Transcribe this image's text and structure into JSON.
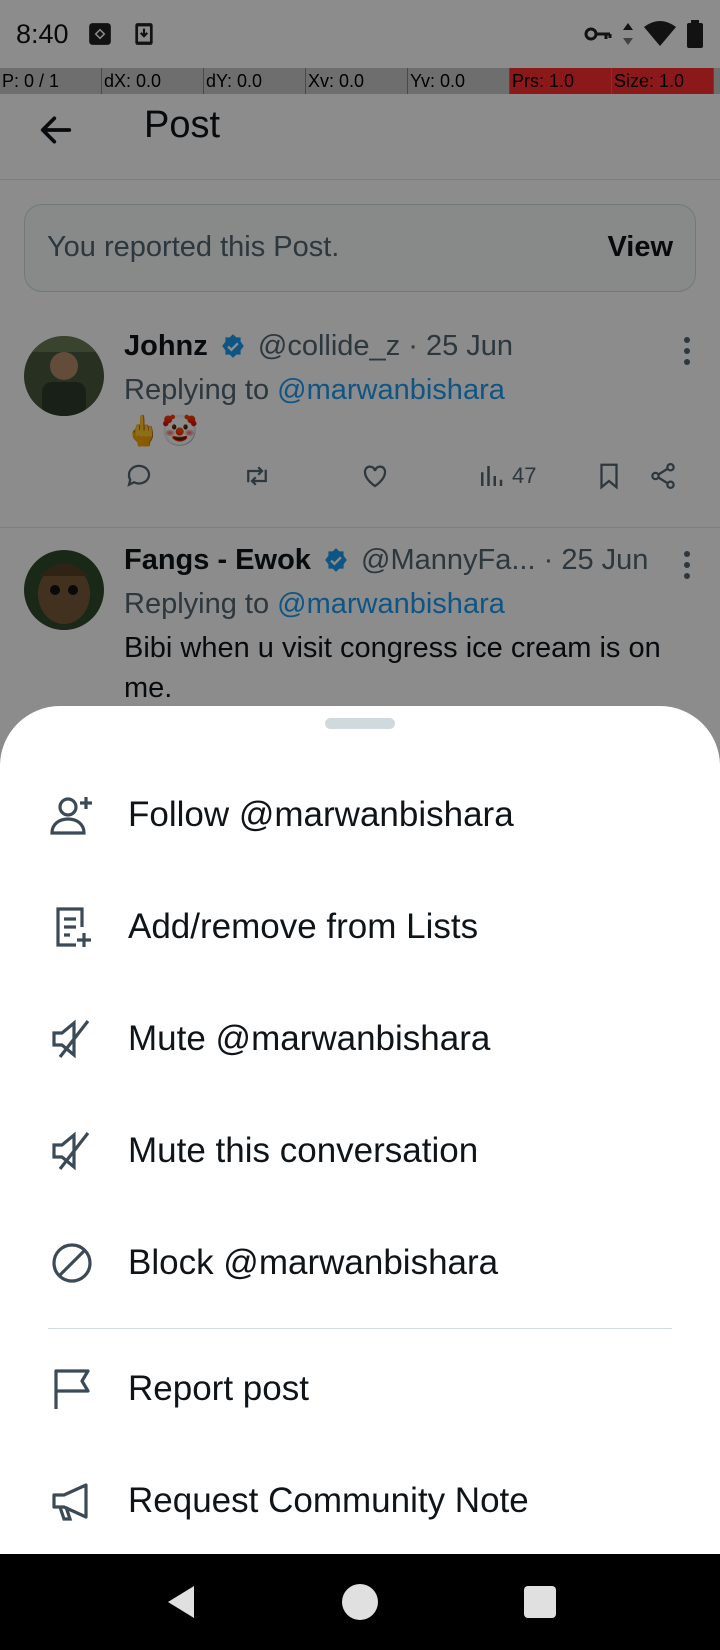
{
  "status_bar": {
    "time": "8:40",
    "icons": [
      "sync-icon",
      "download-icon",
      "vpn-key-icon",
      "data-arrows-icon",
      "wifi-icon",
      "battery-icon"
    ]
  },
  "debug_bar": {
    "p": "P: 0 / 1",
    "dx": "dX: 0.0",
    "dy": "dY: 0.0",
    "xv": "Xv: 0.0",
    "yv": "Yv: 0.0",
    "prs": "Prs: 1.0",
    "size": "Size: 1.0"
  },
  "header": {
    "title": "Post"
  },
  "reported_banner": {
    "text": "You reported this Post.",
    "action": "View"
  },
  "tweets": [
    {
      "name": "Johnz",
      "handle": "@collide_z",
      "sep": "·",
      "date": "25 Jun",
      "replying_prefix": "Replying to",
      "replying_to": "@marwanbishara",
      "body": "🖕🤡",
      "views": "47"
    },
    {
      "name": "Fangs -  Ewok",
      "handle": "@MannyFa...",
      "sep": "·",
      "date": "25 Jun",
      "replying_prefix": "Replying to",
      "replying_to": "@marwanbishara",
      "body": "Bibi when u visit congress ice cream is on me."
    }
  ],
  "sheet": {
    "items": [
      {
        "label": "Follow @marwanbishara",
        "icon": "follow-user-icon"
      },
      {
        "label": "Add/remove from Lists",
        "icon": "list-add-icon"
      },
      {
        "label": "Mute @marwanbishara",
        "icon": "mute-icon"
      },
      {
        "label": "Mute this conversation",
        "icon": "mute-conversation-icon"
      },
      {
        "label": "Block @marwanbishara",
        "icon": "block-icon"
      },
      {
        "label": "Report post",
        "icon": "flag-icon"
      },
      {
        "label": "Request Community Note",
        "icon": "megaphone-icon"
      }
    ]
  },
  "colors": {
    "accent": "#1d9bf0",
    "text": "#0f1419",
    "muted": "#536471",
    "debug_red": "#ff2e2e"
  }
}
